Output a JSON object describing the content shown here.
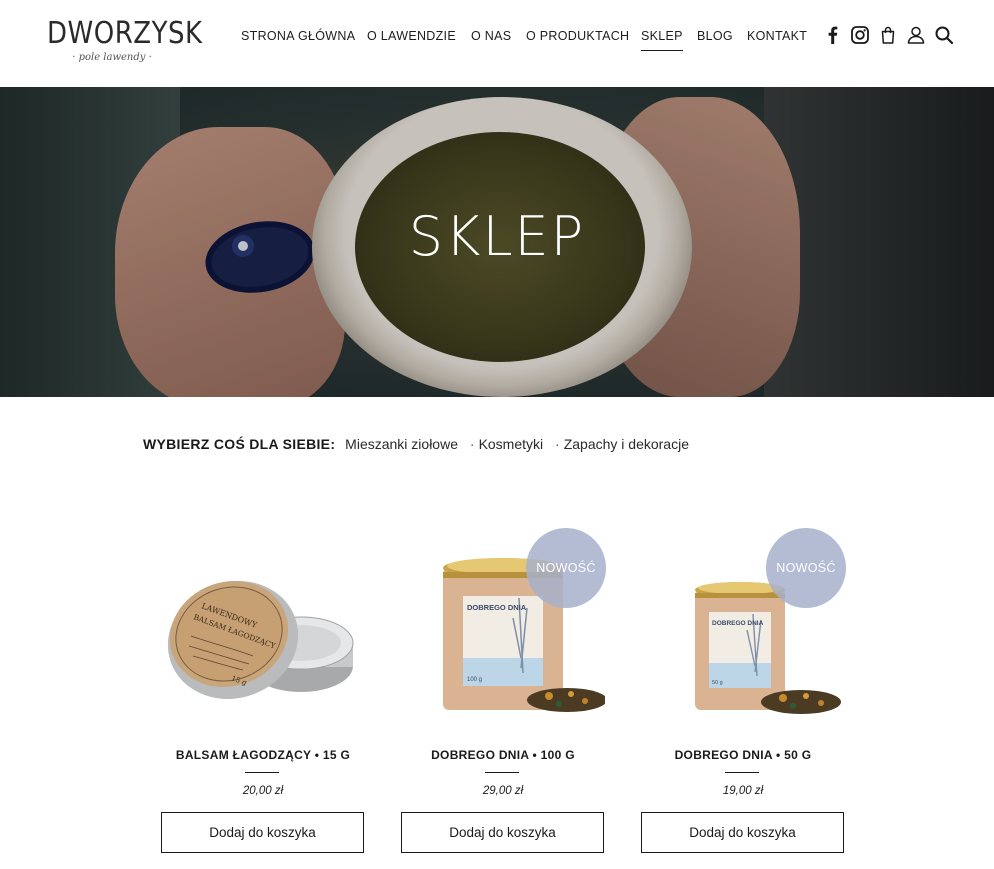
{
  "brand": {
    "name": "DWORZYSK",
    "tagline": "· pole lawendy ·"
  },
  "nav": {
    "items": [
      {
        "label": "STRONA GŁÓWNA"
      },
      {
        "label": "O LAWENDZIE"
      },
      {
        "label": "O NAS"
      },
      {
        "label": "O PRODUKTACH"
      },
      {
        "label": "SKLEP",
        "active": true
      },
      {
        "label": "BLOG"
      },
      {
        "label": "KONTAKT"
      }
    ],
    "icons": [
      "facebook-icon",
      "instagram-icon",
      "cart-icon",
      "user-icon",
      "search-icon"
    ]
  },
  "hero": {
    "title": "SKLEP"
  },
  "filter": {
    "label": "WYBIERZ COŚ DLA SIEBIE:",
    "separator": "·",
    "categories": [
      "Mieszanki ziołowe",
      "Kosmetyki",
      "Zapachy i dekoracje"
    ]
  },
  "products": [
    {
      "title": "BALSAM ŁAGODZĄCY • 15 G",
      "price": "20,00 zł",
      "badge": "",
      "button": "Dodaj do koszyka",
      "label_lines": [
        "LAWENDOWY",
        "BALSAM ŁAGODZĄCY",
        "15 g"
      ]
    },
    {
      "title": "DOBREGO DNIA • 100 G",
      "price": "29,00 zł",
      "badge": "NOWOŚĆ",
      "button": "Dodaj do koszyka",
      "label_lines": [
        "DOBREGO DNIA",
        "100 g"
      ]
    },
    {
      "title": "DOBREGO DNIA • 50 G",
      "price": "19,00 zł",
      "badge": "NOWOŚĆ",
      "button": "Dodaj do koszyka",
      "label_lines": [
        "DOBREGO DNIA",
        "50 g"
      ]
    }
  ],
  "colors": {
    "badge": "#a6b0ca",
    "text": "#1a1a1a"
  }
}
